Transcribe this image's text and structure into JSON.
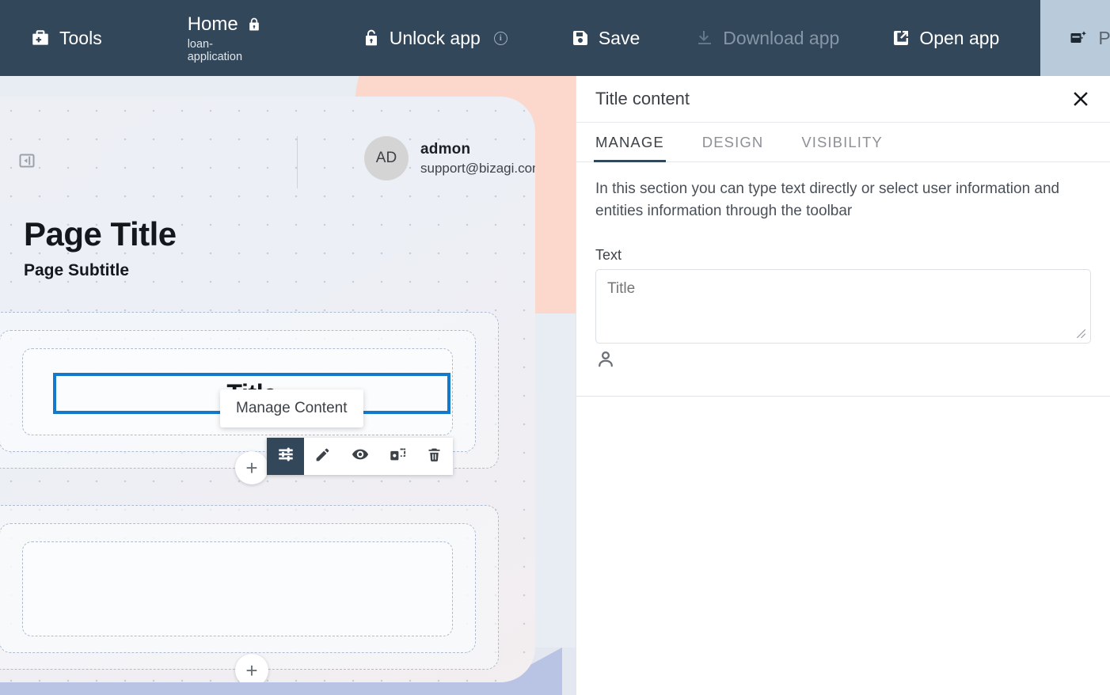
{
  "toolbar": {
    "tools_label": "Tools",
    "home_label": "Home",
    "home_sublabel": "loan-application",
    "unlock_label": "Unlock app",
    "unlock_info": "i",
    "save_label": "Save",
    "download_label": "Download app",
    "open_label": "Open app",
    "publish_label": "Publish",
    "bg_color": "#33475b",
    "publish_bg_color": "#b9cbda"
  },
  "canvas": {
    "user": {
      "initials": "AD",
      "name": "admon",
      "email": "support@bizagi.com"
    },
    "page_title": "Page Title",
    "page_subtitle": "Page Subtitle",
    "title_widget_text": "Title",
    "tooltip_text": "Manage Content",
    "plus_label": "+",
    "selection_color": "#1379cd",
    "widget_tools": [
      {
        "name": "manage-content",
        "active": true
      },
      {
        "name": "edit",
        "active": false
      },
      {
        "name": "visibility",
        "active": false
      },
      {
        "name": "duplicate",
        "active": false
      },
      {
        "name": "delete",
        "active": false
      }
    ]
  },
  "panel": {
    "title": "Title content",
    "tabs": [
      {
        "label": "MANAGE",
        "active": true
      },
      {
        "label": "DESIGN",
        "active": false
      },
      {
        "label": "VISIBILITY",
        "active": false
      }
    ],
    "description": "In this section you can type text directly or select user information and entities information through the toolbar",
    "text_label": "Text",
    "text_value": "Title",
    "text_placeholder": "Title"
  }
}
